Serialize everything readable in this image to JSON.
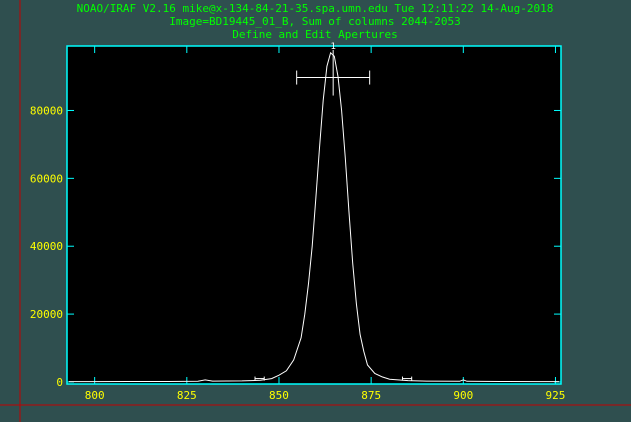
{
  "header": {
    "line1": "NOAO/IRAF V2.16 mike@x-134-84-21-35.spa.umn.edu Tue 12:11:22 14-Aug-2018",
    "line2": "Image=BD19445_01_B, Sum of columns 2044-2053",
    "line3": "Define and Edit Apertures"
  },
  "colors": {
    "background": "#2f4f4f",
    "plot_background": "#000000",
    "axes": "#00ffff",
    "curve": "#ffffff",
    "header_text": "#00ff00",
    "tick_text": "#ffff00",
    "crosshair": "#c00000"
  },
  "chart_data": {
    "type": "line",
    "title": "Define and Edit Apertures",
    "xlabel": "",
    "ylabel": "",
    "xlim": [
      792.5,
      926.5
    ],
    "ylim": [
      -600,
      99000
    ],
    "xticks": [
      800,
      825,
      850,
      875,
      900,
      925
    ],
    "yticks": [
      0,
      20000,
      40000,
      60000,
      80000
    ],
    "grid": false,
    "series": [
      {
        "x": [
          793,
          800,
          810,
          820,
          828,
          830,
          832,
          840,
          845,
          848,
          850,
          852,
          854,
          856,
          857,
          858,
          859,
          860,
          861,
          862,
          863,
          864,
          865,
          866,
          867,
          868,
          869,
          870,
          871,
          872,
          873,
          874,
          876,
          878,
          880,
          885,
          890,
          899,
          900,
          901,
          910,
          920,
          926
        ],
        "y": [
          100,
          100,
          150,
          150,
          200,
          600,
          250,
          300,
          500,
          1000,
          2000,
          3300,
          6500,
          13000,
          20000,
          29000,
          40000,
          54000,
          69000,
          83000,
          93000,
          97000,
          96000,
          90000,
          80000,
          66000,
          50000,
          35000,
          23000,
          14000,
          9000,
          5000,
          2500,
          1500,
          800,
          400,
          250,
          200,
          600,
          200,
          150,
          100,
          100
        ]
      }
    ],
    "aperture": {
      "label": "1",
      "center": 864.7,
      "lower": 854.8,
      "upper": 874.6,
      "level": 89700
    },
    "background_regions": [
      [
        843.5,
        846.0
      ],
      [
        883.5,
        886.0
      ]
    ]
  }
}
